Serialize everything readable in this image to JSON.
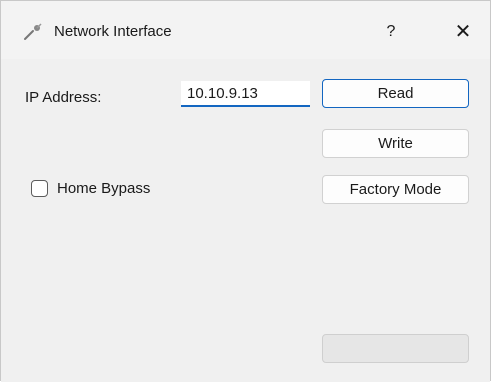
{
  "window": {
    "title": "Network Interface",
    "help_glyph": "?",
    "close_glyph": "✕"
  },
  "form": {
    "ip_label": "IP Address:",
    "ip_value": "10.10.9.13",
    "home_bypass_label": "Home Bypass",
    "home_bypass_checked": false
  },
  "buttons": {
    "read": "Read",
    "write": "Write",
    "factory_mode": "Factory Mode",
    "bottom": ""
  },
  "colors": {
    "accent": "#1366c1",
    "background": "#f0f0f0"
  }
}
